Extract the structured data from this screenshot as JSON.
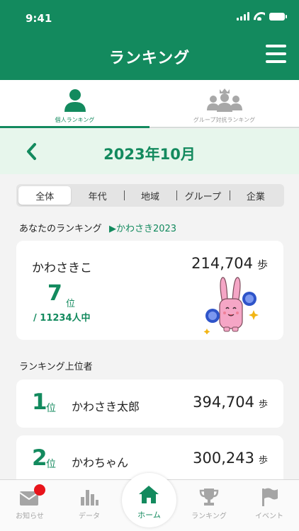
{
  "status_bar": {
    "time": "9:41"
  },
  "header": {
    "title": "ランキング"
  },
  "tabs": [
    {
      "label": "個人ランキング",
      "active": true
    },
    {
      "label": "グループ対抗ランキング",
      "active": false
    }
  ],
  "month_nav": {
    "month": "2023年10月"
  },
  "segments": [
    {
      "label": "全体",
      "active": true
    },
    {
      "label": "年代",
      "active": false
    },
    {
      "label": "地域",
      "active": false
    },
    {
      "label": "グループ",
      "active": false
    },
    {
      "label": "企業",
      "active": false
    }
  ],
  "my_section": {
    "heading": "あなたのランキング",
    "affiliation": "▶かわさき2023",
    "name": "かわさきこ",
    "steps": "214,704",
    "steps_unit": "歩",
    "rank": "7",
    "rank_unit": "位",
    "total": "/ 11234人中"
  },
  "top_section": {
    "heading": "ランキング上位者",
    "rows": [
      {
        "rank": "1",
        "rank_unit": "位",
        "name": "かわさき太郎",
        "steps": "394,704",
        "steps_unit": "歩"
      },
      {
        "rank": "2",
        "rank_unit": "位",
        "name": "かわちゃん",
        "steps": "300,243",
        "steps_unit": "歩"
      }
    ]
  },
  "bottom_nav": [
    {
      "label": "お知らせ",
      "icon": "mail-icon"
    },
    {
      "label": "データ",
      "icon": "bar-chart-icon"
    },
    {
      "label": "ホーム",
      "icon": "home-icon",
      "active": true
    },
    {
      "label": "ランキング",
      "icon": "trophy-icon"
    },
    {
      "label": "イベント",
      "icon": "flag-icon"
    }
  ],
  "colors": {
    "brand": "#138a5e",
    "light_green": "#e7f6ec",
    "badge": "#e8141b"
  }
}
